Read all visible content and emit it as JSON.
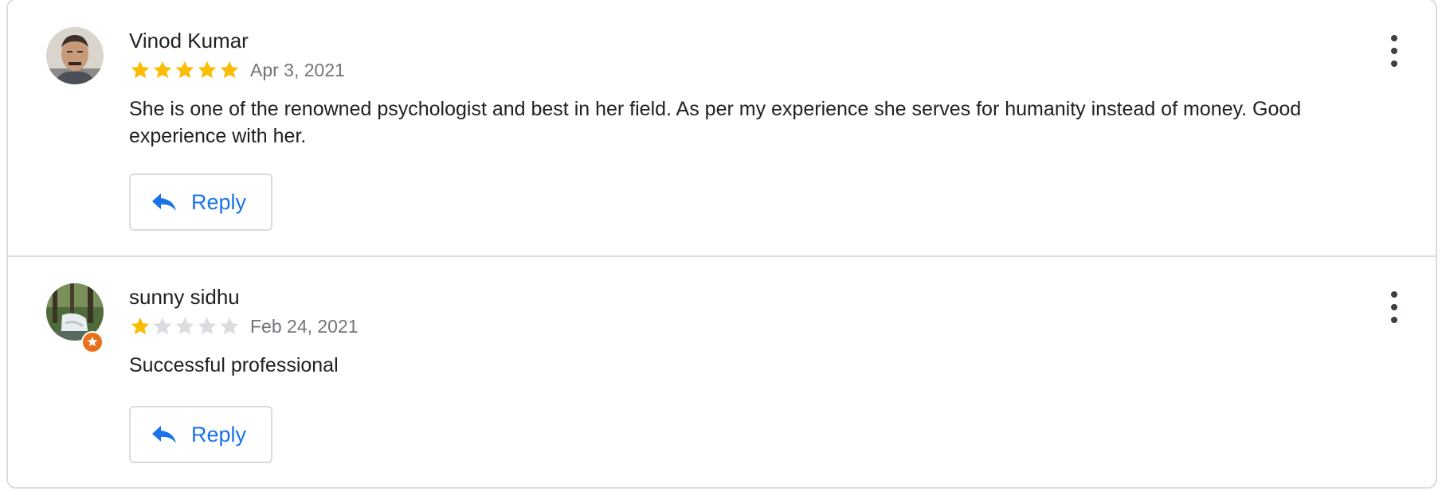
{
  "reviews": [
    {
      "author": "Vinod Kumar",
      "rating": 5,
      "rating_max": 5,
      "date": "Apr 3, 2021",
      "text": "She is one of the renowned psychologist and best in her field. As per my experience she serves for humanity instead of money. Good experience with her.",
      "reply_label": "Reply",
      "avatar_icon": "person-photo",
      "more_icon": "more-vert-icon"
    },
    {
      "author": "sunny sidhu",
      "rating": 1,
      "rating_max": 5,
      "date": "Feb 24, 2021",
      "text": "Successful professional",
      "reply_label": "Reply",
      "avatar_icon": "waterfall-photo",
      "badge_icon": "local-guide-badge-icon",
      "more_icon": "more-vert-icon"
    }
  ],
  "colors": {
    "star_filled": "#fbbc04",
    "star_empty": "#dadce0",
    "reply_blue": "#1a73e8",
    "badge_orange": "#e8711a",
    "border": "#dadce0"
  }
}
